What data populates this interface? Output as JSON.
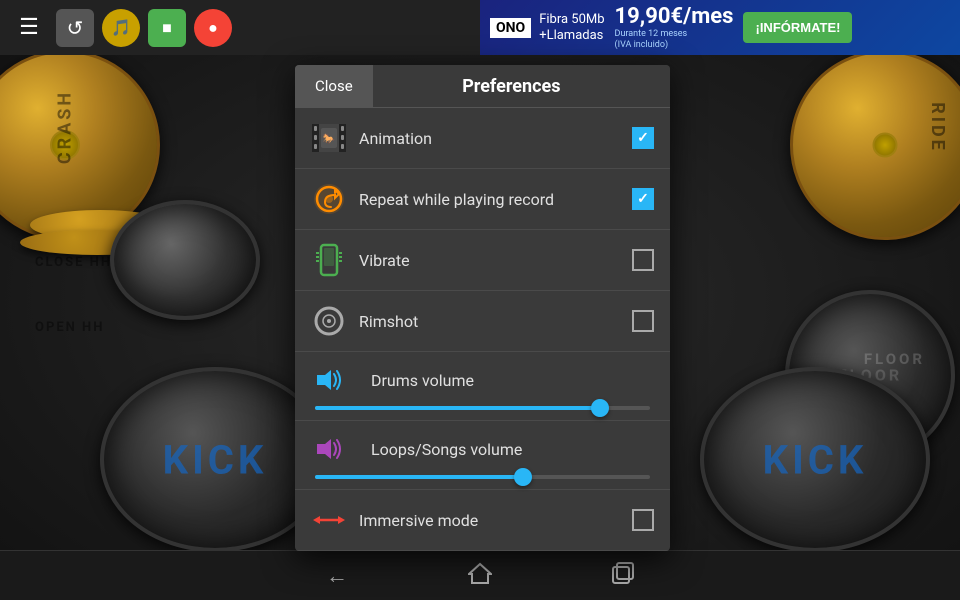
{
  "toolbar": {
    "menu_label": "☰",
    "refresh_label": "↺",
    "metronome_label": "♩",
    "green_label": "■",
    "red_label": "●"
  },
  "ad": {
    "brand": "ONO",
    "line1": "Fibra 50Mb",
    "line2": "+Llamadas",
    "price": "19,90€/mes",
    "small1": "Durante 12 meses",
    "small2": "(IVA incluido)",
    "cta": "¡INFÓRMATE!"
  },
  "dialog": {
    "close_label": "Close",
    "title": "Preferences",
    "items": [
      {
        "id": "animation",
        "label": "Animation",
        "icon_type": "film",
        "checked": true,
        "has_checkbox": true
      },
      {
        "id": "repeat",
        "label": "Repeat while playing record",
        "icon_type": "repeat",
        "checked": true,
        "has_checkbox": true
      },
      {
        "id": "vibrate",
        "label": "Vibrate",
        "icon_type": "vibrate",
        "checked": false,
        "has_checkbox": true
      },
      {
        "id": "rimshot",
        "label": "Rimshot",
        "icon_type": "rimshot",
        "checked": false,
        "has_checkbox": true
      }
    ],
    "sliders": [
      {
        "id": "drums_volume",
        "label": "Drums volume",
        "icon_type": "speaker_blue",
        "value": 85
      },
      {
        "id": "loops_volume",
        "label": "Loops/Songs volume",
        "icon_type": "speaker_purple",
        "value": 62
      }
    ],
    "immersive": {
      "label": "Immersive mode",
      "icon_type": "immersive",
      "checked": false
    }
  },
  "drum_labels": {
    "crash": "CRASH",
    "ride": "RIDE",
    "close_hh": "CLOSE HH",
    "open_hh": "OPEN HH",
    "kick": "KICK",
    "floor": "FLOOR"
  },
  "nav": {
    "back": "←",
    "home": "⌂",
    "recent": "▣"
  }
}
